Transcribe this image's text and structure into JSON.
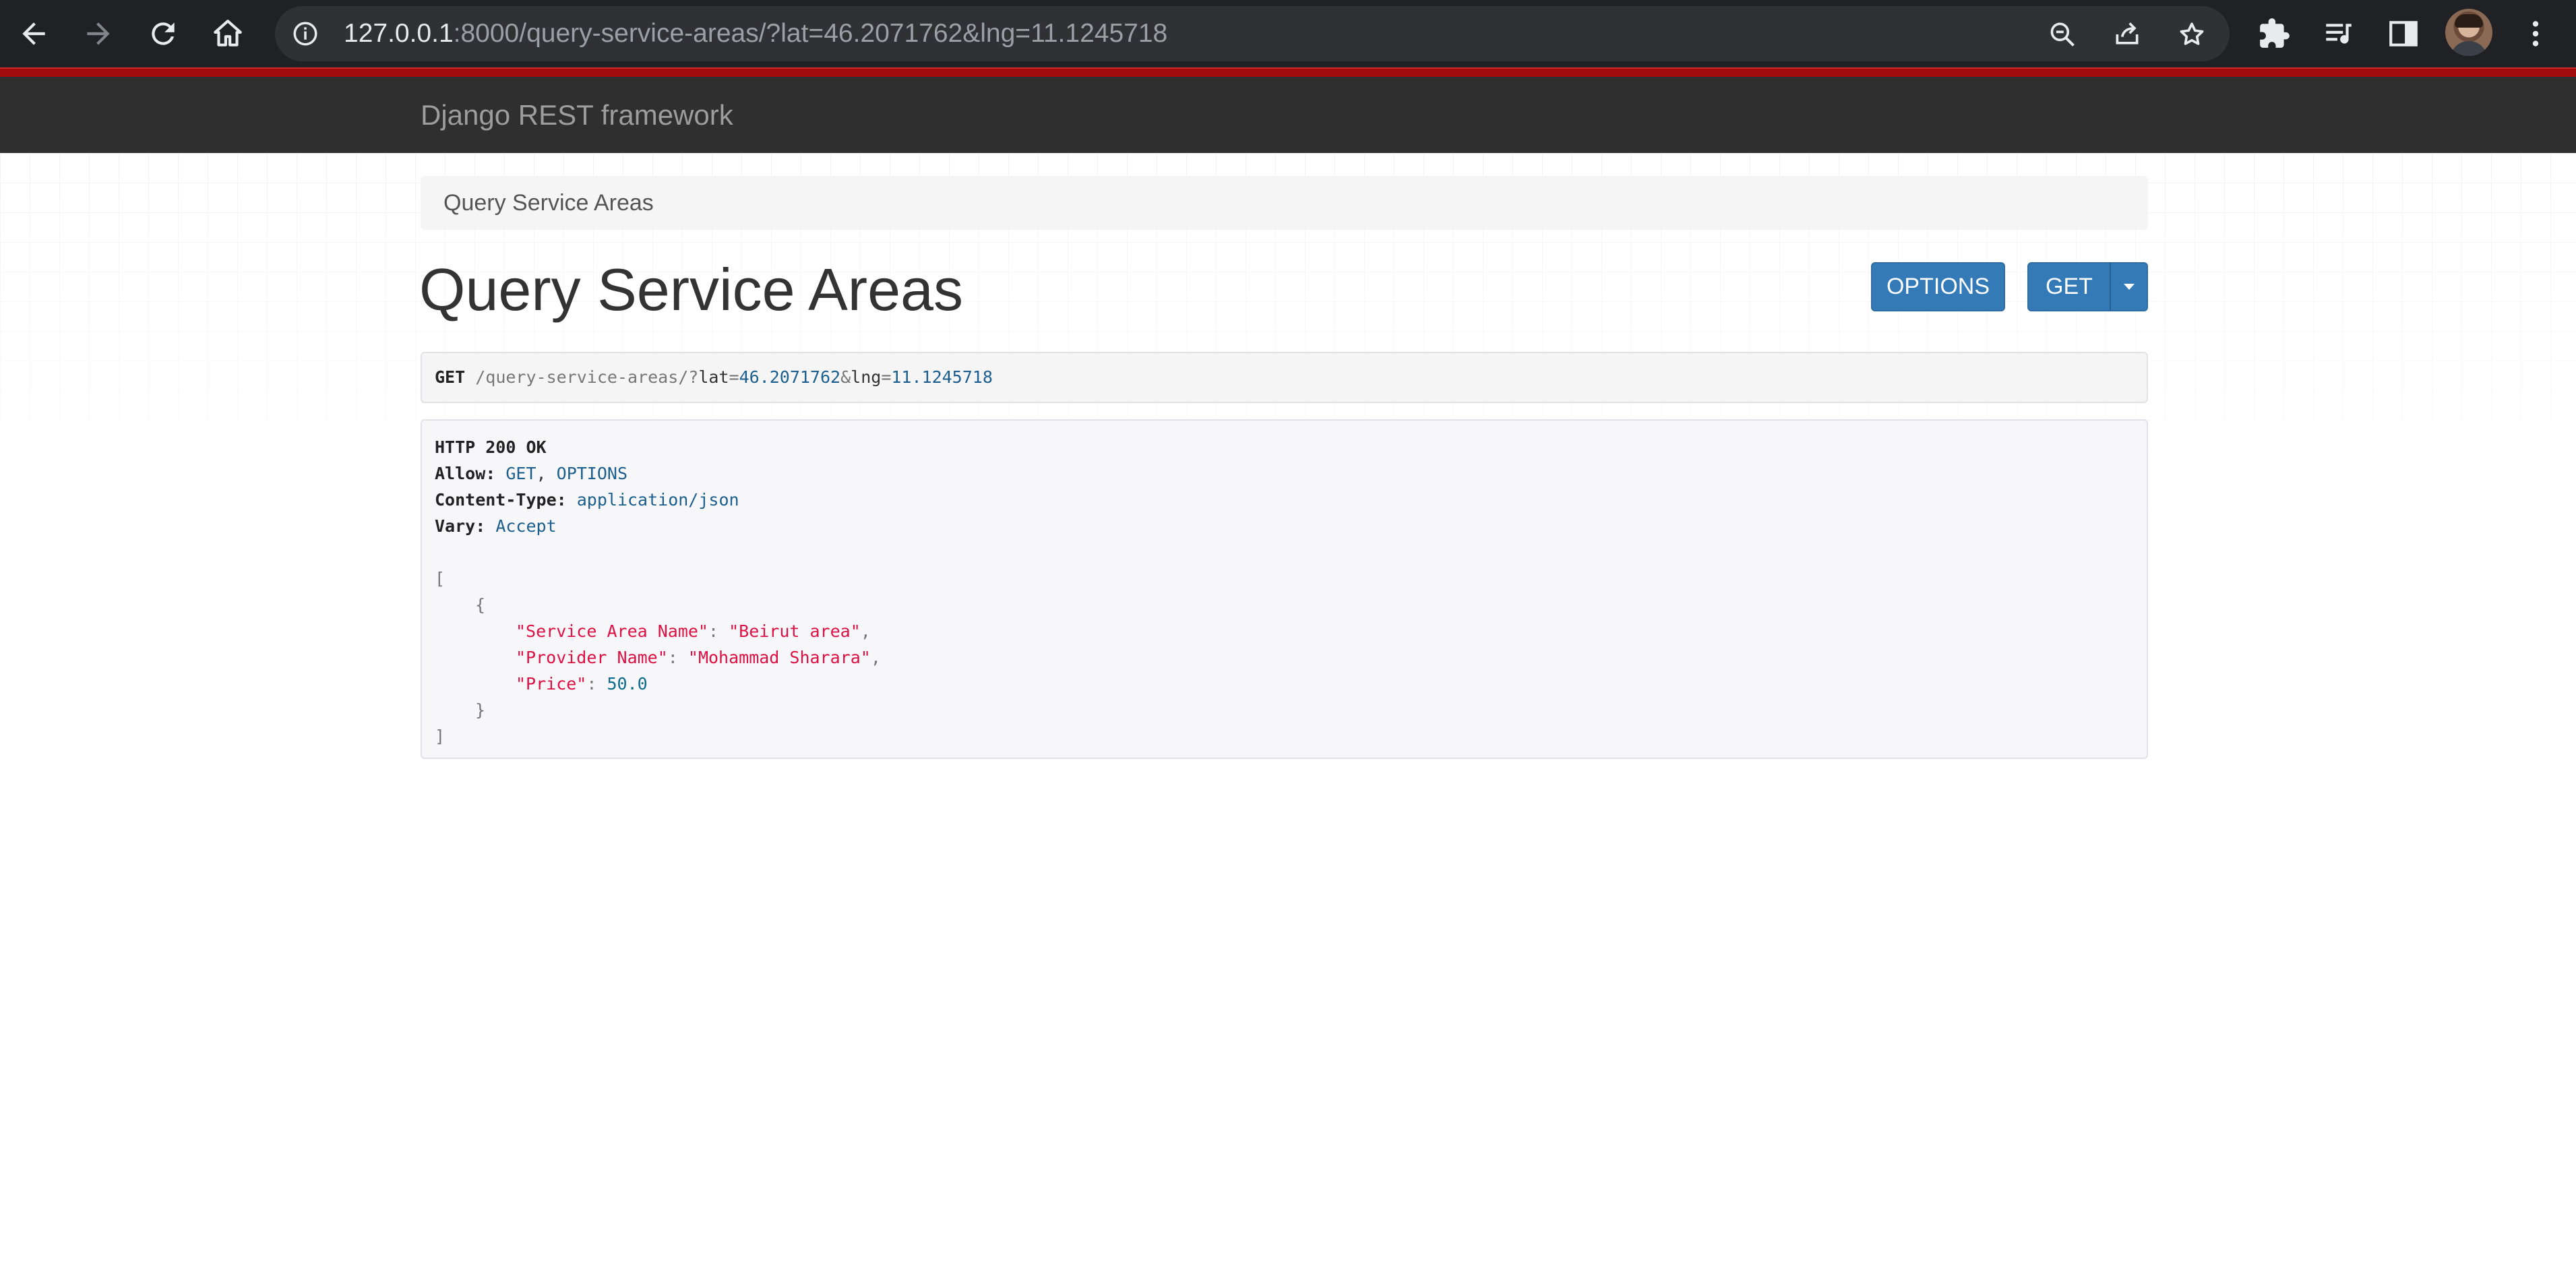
{
  "browser": {
    "url_host": "127.0.0.1",
    "url_rest": ":8000/query-service-areas/?lat=46.2071762&lng=11.1245718",
    "icons": [
      "back-icon",
      "forward-icon",
      "reload-icon",
      "home-icon",
      "info-icon",
      "zoom-out-icon",
      "share-icon",
      "star-icon",
      "extensions-icon",
      "reading-list-icon",
      "side-panel-icon",
      "avatar",
      "menu-icon"
    ]
  },
  "navbar": {
    "brand": "Django REST framework"
  },
  "breadcrumb": {
    "current": "Query Service Areas"
  },
  "page": {
    "title": "Query Service Areas",
    "options_button": "OPTIONS",
    "get_button": "GET"
  },
  "request": {
    "method": "GET",
    "path": "/query-service-areas/",
    "q": "?",
    "lat_key": "lat",
    "eq1": "=",
    "lat_value": "46.2071762",
    "amp": "&",
    "lng_key": "lng",
    "eq2": "=",
    "lng_value": "11.1245718"
  },
  "response": {
    "status": "HTTP 200 OK",
    "headers": [
      {
        "name": "Allow:",
        "value_1": "GET",
        "sep": ", ",
        "value_2": "OPTIONS"
      },
      {
        "name": "Content-Type:",
        "value": "application/json"
      },
      {
        "name": "Vary:",
        "value": "Accept"
      }
    ],
    "body": {
      "open_bracket": "[",
      "open_brace": "{",
      "fields": [
        {
          "key": "\"Service Area Name\"",
          "colon": ": ",
          "value": "\"Beirut area\"",
          "comma": ","
        },
        {
          "key": "\"Provider Name\"",
          "colon": ": ",
          "value": "\"Mohammad Sharara\"",
          "comma": ","
        },
        {
          "key": "\"Price\"",
          "colon": ": ",
          "value": "50.0",
          "comma": ""
        }
      ],
      "close_brace": "}",
      "close_bracket": "]"
    }
  },
  "colors": {
    "accent_red": "#a10b0b",
    "button_blue": "#337ab7",
    "navbar_bg": "#2f2f2f"
  }
}
